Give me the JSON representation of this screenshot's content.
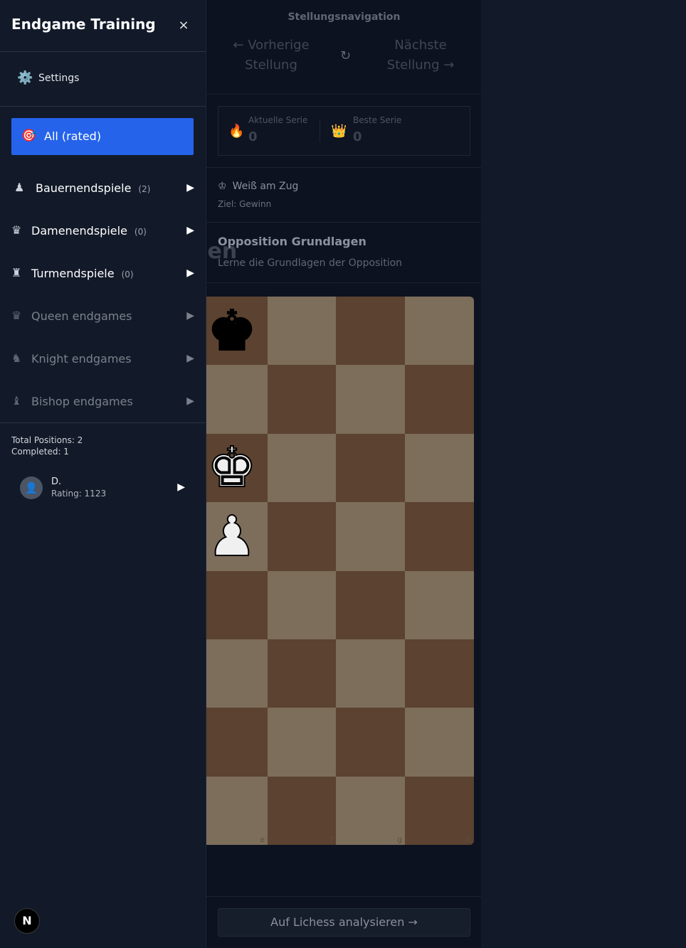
{
  "sidebar": {
    "title": "Endgame Training",
    "close_icon": "×",
    "settings": {
      "icon": "⚙️",
      "label": "Settings"
    },
    "all_rated": {
      "icon": "🎯",
      "label": "All (rated)"
    },
    "categories": [
      {
        "icon": "♟",
        "label": "Bauernendspiele",
        "count": "(2)",
        "arrow": "▶"
      },
      {
        "icon": "♛",
        "label": "Damenendspiele",
        "count": "(0)",
        "arrow": "▶"
      },
      {
        "icon": "♜",
        "label": "Turmendspiele",
        "count": "(0)",
        "arrow": "▶"
      },
      {
        "icon": "♛",
        "label": "Queen endgames",
        "arrow": "▶"
      },
      {
        "icon": "♞",
        "label": "Knight endgames",
        "arrow": "▶"
      },
      {
        "icon": "♝",
        "label": "Bishop endgames",
        "arrow": "▶"
      }
    ],
    "stats": {
      "total": "Total Positions: 2",
      "completed": "Completed: 1"
    },
    "user": {
      "avatar_icon": "👤",
      "name": "D.",
      "rating": "Rating: 1123",
      "arrow": "▶"
    },
    "logo_letter": "N"
  },
  "main": {
    "nav_title": "Stellungsnavigation",
    "prev": {
      "line1": "← Vorherige",
      "line2": "Stellung"
    },
    "next": {
      "line1": "Nächste",
      "line2": "Stellung →"
    },
    "refresh_icon": "↻",
    "streak": {
      "current": {
        "icon": "🔥",
        "label": "Aktuelle Serie",
        "value": "0"
      },
      "best": {
        "icon": "👑",
        "label": "Beste Serie",
        "value": "0"
      }
    },
    "turn": {
      "icon": "♔",
      "label": "Weiß am Zug"
    },
    "goal": "Ziel: Gewinn",
    "ghost_title": "gen",
    "position_title": "Opposition Grundlagen",
    "position_desc": "Lerne die Grundlagen der Opposition",
    "board": {
      "files": [
        "e",
        "f",
        "g",
        "h"
      ],
      "pieces": [
        {
          "square": "e8",
          "glyph": "♚",
          "color": "#000000"
        },
        {
          "square": "e6",
          "glyph": "♚",
          "color": "#f0f0f0"
        },
        {
          "square": "e5",
          "glyph": "♟",
          "color": "#f0f0f0"
        }
      ]
    },
    "lichess_button": "Auf Lichess analysieren →"
  }
}
